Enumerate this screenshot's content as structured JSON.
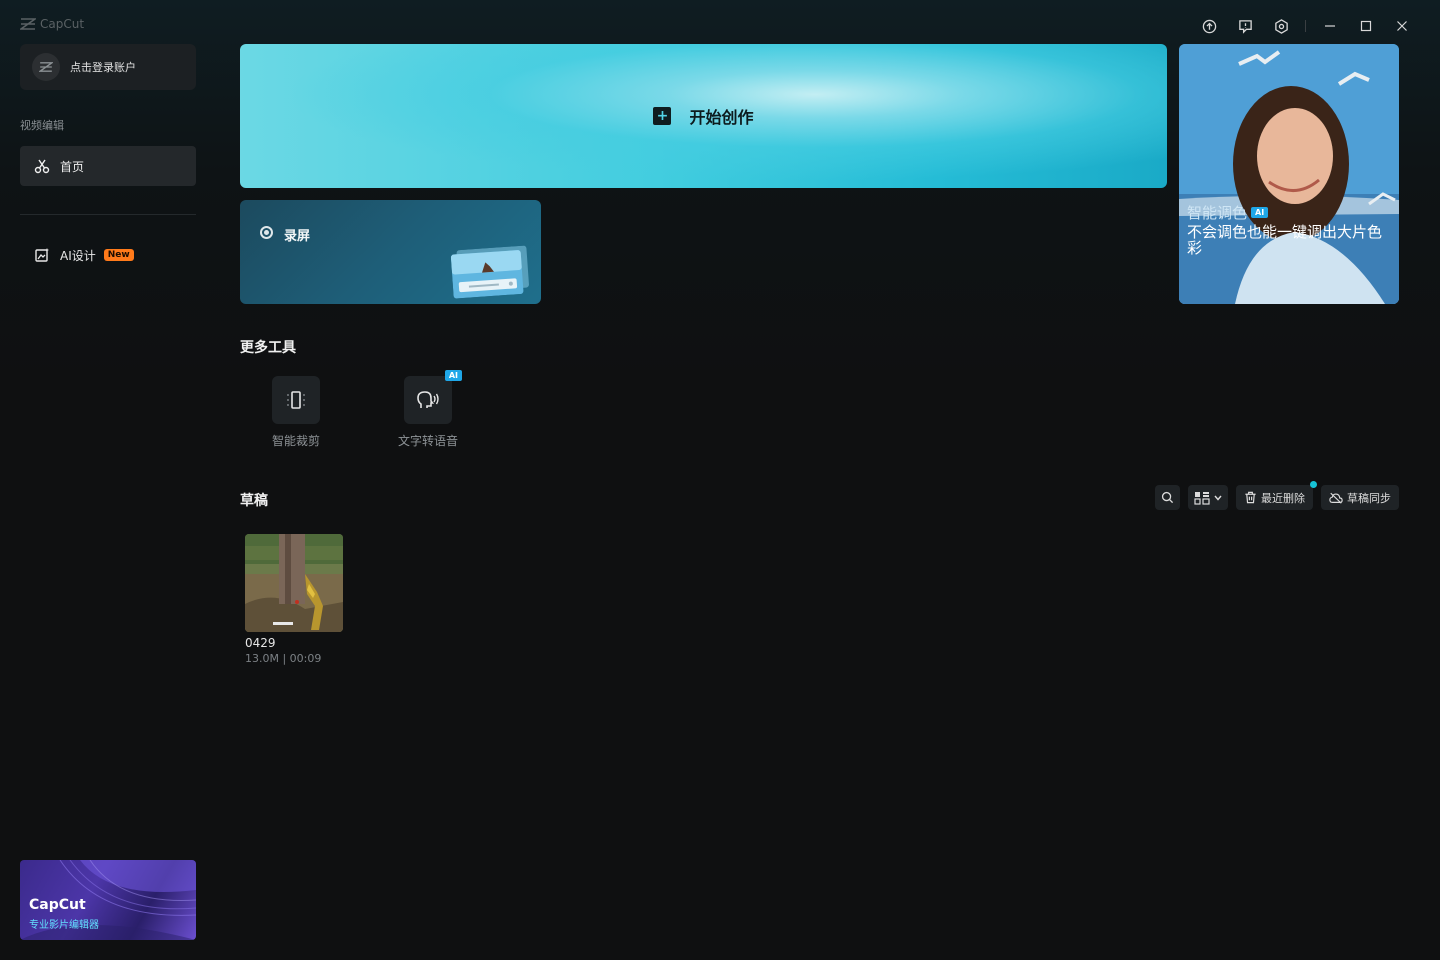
{
  "app": {
    "logo_text": "CapCut"
  },
  "sidebar": {
    "login_label": "点击登录账户",
    "section_label": "视频编辑",
    "home_label": "首页",
    "ai_design_label": "AI设计",
    "new_badge": "New",
    "promo_title": "CapCut",
    "promo_subtitle": "专业影片编辑器"
  },
  "main": {
    "start_label": "开始创作",
    "record_label": "录屏",
    "ad": {
      "title": "智能调色",
      "ai_tag": "AI",
      "subtitle": "不会调色也能一键调出大片色彩"
    },
    "more_tools_title": "更多工具",
    "tools": [
      {
        "label": "智能裁剪",
        "icon": "crop-icon"
      },
      {
        "label": "文字转语音",
        "icon": "text-to-speech-icon",
        "badge": "AI"
      }
    ],
    "drafts_title": "草稿",
    "drafts_toolbar": {
      "recent_delete": "最近删除",
      "draft_sync": "草稿同步"
    },
    "drafts": [
      {
        "name": "0429",
        "meta": "13.0M | 00:09"
      }
    ]
  },
  "colors": {
    "accent": "#16c3d6",
    "new_badge": "#ff7a1a",
    "ai_badge": "#1fa7e8"
  }
}
